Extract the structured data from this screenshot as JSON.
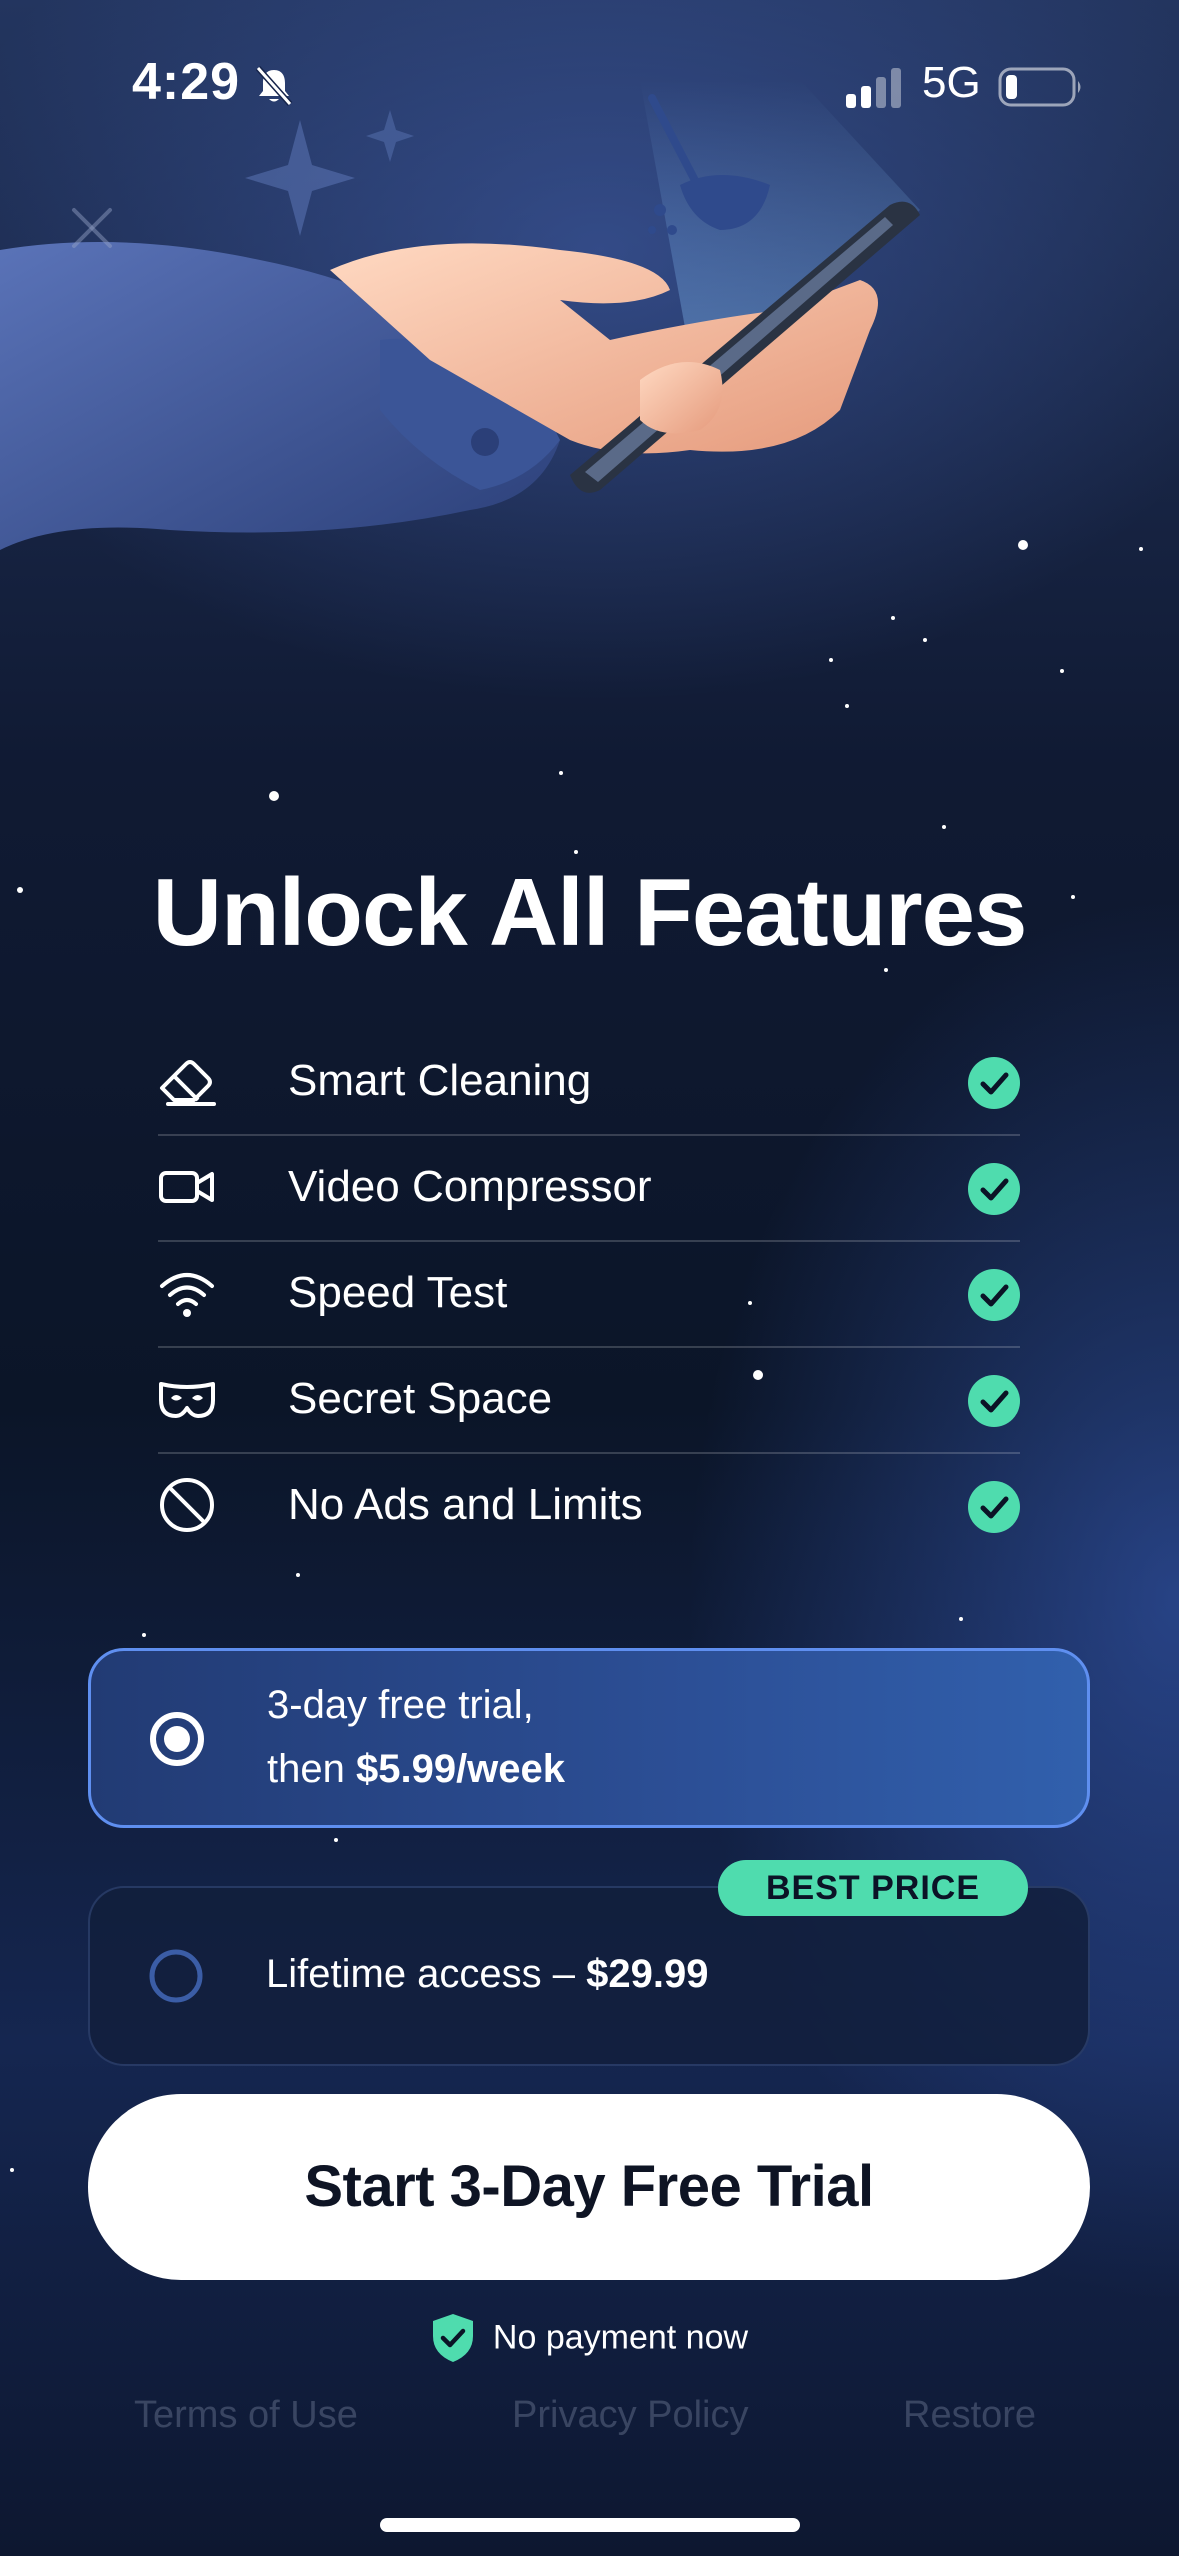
{
  "status_bar": {
    "time": "4:29",
    "network": "5G",
    "icons": [
      "bell-slash-icon",
      "signal-icon",
      "battery-icon"
    ]
  },
  "paywall": {
    "title": "Unlock All Features",
    "features": [
      {
        "label": "Smart Cleaning",
        "icon": "eraser-icon"
      },
      {
        "label": "Video Compressor",
        "icon": "video-camera-icon"
      },
      {
        "label": "Speed Test",
        "icon": "wifi-icon"
      },
      {
        "label": "Secret Space",
        "icon": "mask-icon"
      },
      {
        "label": "No Ads and Limits",
        "icon": "no-symbol-icon"
      }
    ],
    "plans": {
      "weekly": {
        "line1": "3-day free trial,",
        "line2_prefix": "then ",
        "line2_price": "$5.99/week",
        "selected": true
      },
      "lifetime": {
        "label_prefix": "Lifetime access – ",
        "price": "$29.99",
        "badge": "BEST PRICE",
        "selected": false
      }
    },
    "cta_label": "Start 3-Day Free Trial",
    "no_payment": "No payment now",
    "footer": {
      "terms": "Terms of Use",
      "privacy": "Privacy Policy",
      "restore": "Restore"
    }
  },
  "colors": {
    "accent_green": "#4fdcae",
    "selected_border": "#5f8ff0",
    "background": "#0b1326"
  }
}
